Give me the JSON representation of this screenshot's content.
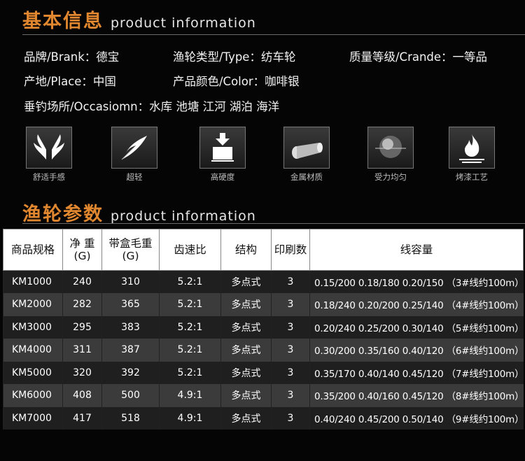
{
  "section1": {
    "title_cn": "基本信息",
    "title_en": "product information"
  },
  "info": {
    "brand": "品牌/Brank：德宝",
    "type": "渔轮类型/Type：纺车轮",
    "grade": "质量等级/Crande：一等品",
    "place": "产地/Place：中国",
    "color": "产品颜色/Color：咖啡银",
    "occasion": "垂钓场所/Occasiomn：水库  池塘  江河  湖泊  海洋"
  },
  "features": [
    {
      "label": "舒适手感",
      "icon": "hands-icon"
    },
    {
      "label": "超轻",
      "icon": "feather-icon"
    },
    {
      "label": "高硬度",
      "icon": "hardness-press-icon"
    },
    {
      "label": "金属材质",
      "icon": "metal-bar-icon"
    },
    {
      "label": "受力均匀",
      "icon": "sphere-icon"
    },
    {
      "label": "烤漆工艺",
      "icon": "flame-icon"
    }
  ],
  "section2": {
    "title_cn": "渔轮参数",
    "title_en": "product information"
  },
  "table": {
    "headers": {
      "model": "商品规格",
      "net_weight_1": "净 重",
      "net_weight_2": "(G)",
      "gross_weight_1": "带盒毛重",
      "gross_weight_2": "(G)",
      "ratio": "齿速比",
      "structure": "结构",
      "print": "印刷数",
      "capacity": "线容量"
    },
    "rows": [
      {
        "model": "KM1000",
        "net": "240",
        "gross": "310",
        "ratio": "5.2:1",
        "structure": "多点式",
        "print": "3",
        "capacity": "0.15/200  0.18/180  0.20/150 （3#线约100m）"
      },
      {
        "model": "KM2000",
        "net": "282",
        "gross": "365",
        "ratio": "5.2:1",
        "structure": "多点式",
        "print": "3",
        "capacity": "0.18/240  0.20/200  0.25/140 （4#线约100m）"
      },
      {
        "model": "KM3000",
        "net": "295",
        "gross": "383",
        "ratio": "5.2:1",
        "structure": "多点式",
        "print": "3",
        "capacity": "0.20/240  0.25/200  0.30/140 （5#线约100m）"
      },
      {
        "model": "KM4000",
        "net": "311",
        "gross": "387",
        "ratio": "5.2:1",
        "structure": "多点式",
        "print": "3",
        "capacity": "0.30/200  0.35/160  0.40/120 （6#线约100m）"
      },
      {
        "model": "KM5000",
        "net": "320",
        "gross": "392",
        "ratio": "5.2:1",
        "structure": "多点式",
        "print": "3",
        "capacity": "0.35/170  0.40/140  0.45/120 （7#线约100m）"
      },
      {
        "model": "KM6000",
        "net": "408",
        "gross": "500",
        "ratio": "4.9:1",
        "structure": "多点式",
        "print": "3",
        "capacity": "0.35/200  0.40/160  0.45/120 （8#线约100m）"
      },
      {
        "model": "KM7000",
        "net": "417",
        "gross": "518",
        "ratio": "4.9:1",
        "structure": "多点式",
        "print": "3",
        "capacity": "0.40/240  0.45/200  0.50/140 （9#线约100m）"
      }
    ]
  }
}
